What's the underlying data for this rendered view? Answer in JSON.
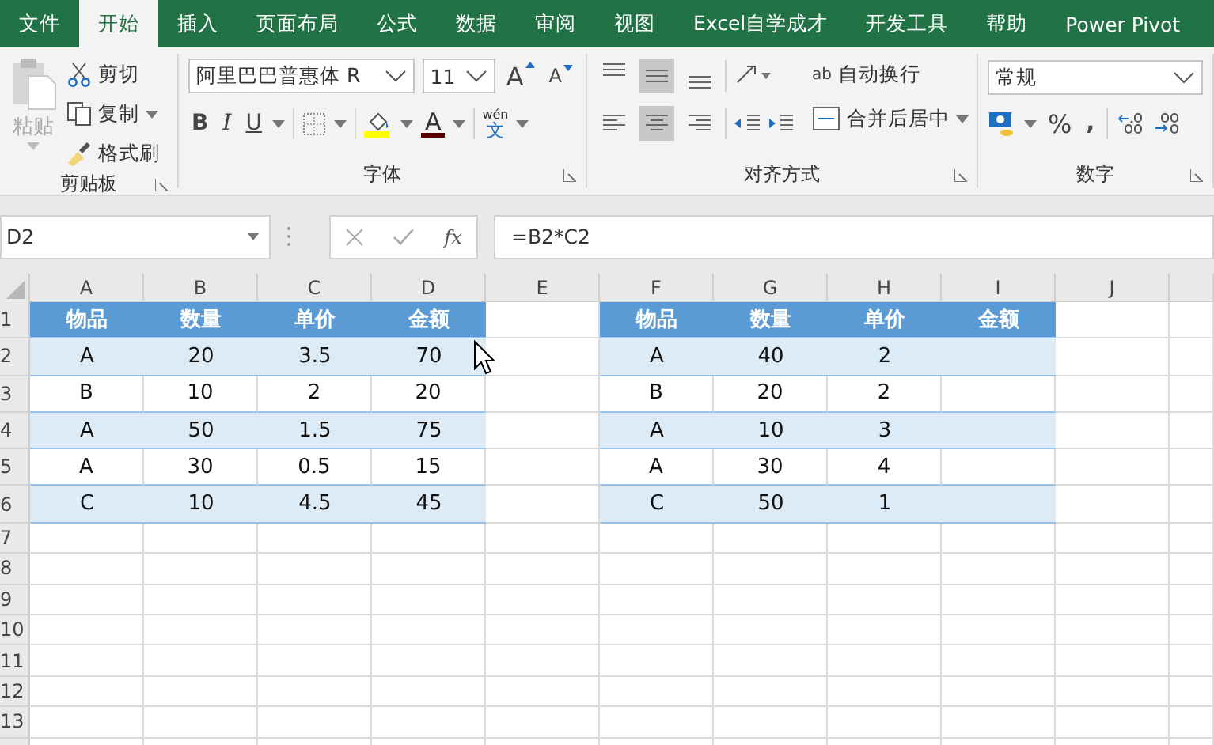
{
  "tabs": [
    {
      "label": "文件",
      "selected": false
    },
    {
      "label": "开始",
      "selected": true
    },
    {
      "label": "插入",
      "selected": false
    },
    {
      "label": "页面布局",
      "selected": false
    },
    {
      "label": "公式",
      "selected": false
    },
    {
      "label": "数据",
      "selected": false
    },
    {
      "label": "审阅",
      "selected": false
    },
    {
      "label": "视图",
      "selected": false
    },
    {
      "label": "Excel自学成才",
      "selected": false
    },
    {
      "label": "开发工具",
      "selected": false
    },
    {
      "label": "帮助",
      "selected": false
    },
    {
      "label": "Power Pivot",
      "selected": false
    }
  ],
  "clipboard": {
    "paste": "粘贴",
    "cut": "剪切",
    "copy": "复制",
    "painter": "格式刷",
    "label": "剪贴板"
  },
  "font": {
    "name": "阿里巴巴普惠体 R",
    "size": "11",
    "grow": "A",
    "shrink": "A",
    "bold": "B",
    "italic": "I",
    "underline": "U",
    "color_letter": "A",
    "phonetic_top": "wén",
    "phonetic_bottom": "文",
    "label": "字体"
  },
  "alignment": {
    "top_row": [
      {
        "kind": "top",
        "selected": false
      },
      {
        "kind": "middle",
        "selected": true
      },
      {
        "kind": "bottom",
        "selected": false
      }
    ],
    "bottom_row": [
      {
        "kind": "left",
        "selected": false
      },
      {
        "kind": "center",
        "selected": true
      },
      {
        "kind": "right",
        "selected": false
      }
    ],
    "wrap_icon": "ab",
    "wrap": "自动换行",
    "merge": "合并后居中",
    "label": "对齐方式"
  },
  "number": {
    "format": "常规",
    "percent": "%",
    "comma": ",",
    "label": "数字"
  },
  "formula_bar": {
    "name_box": "D2",
    "fx": "fx",
    "formula": "=B2*C2"
  },
  "sheet": {
    "columns": [
      "A",
      "B",
      "C",
      "D",
      "E",
      "F",
      "G",
      "H",
      "I",
      "J"
    ],
    "rows": [
      {
        "number": "1",
        "cells": [
          {
            "text": "物品",
            "kind": "header"
          },
          {
            "text": "数量",
            "kind": "header"
          },
          {
            "text": "单价",
            "kind": "header"
          },
          {
            "text": "金额",
            "kind": "header"
          },
          {
            "kind": "empty"
          },
          {
            "text": "物品",
            "kind": "header"
          },
          {
            "text": "数量",
            "kind": "header"
          },
          {
            "text": "单价",
            "kind": "header"
          },
          {
            "text": "金额",
            "kind": "header"
          },
          {
            "kind": "empty"
          }
        ]
      },
      {
        "number": "2",
        "cells": [
          {
            "text": "A",
            "kind": "band"
          },
          {
            "text": "20",
            "kind": "band"
          },
          {
            "text": "3.5",
            "kind": "band"
          },
          {
            "text": "70",
            "kind": "band"
          },
          {
            "kind": "empty"
          },
          {
            "text": "A",
            "kind": "band"
          },
          {
            "text": "40",
            "kind": "band"
          },
          {
            "text": "2",
            "kind": "band"
          },
          {
            "kind": "band"
          },
          {
            "kind": "empty"
          }
        ]
      },
      {
        "number": "3",
        "cells": [
          {
            "text": "B",
            "kind": "plain"
          },
          {
            "text": "10",
            "kind": "plain"
          },
          {
            "text": "2",
            "kind": "plain"
          },
          {
            "text": "20",
            "kind": "plain"
          },
          {
            "kind": "empty"
          },
          {
            "text": "B",
            "kind": "plain"
          },
          {
            "text": "20",
            "kind": "plain"
          },
          {
            "text": "2",
            "kind": "plain"
          },
          {
            "kind": "plain"
          },
          {
            "kind": "empty"
          }
        ]
      },
      {
        "number": "4",
        "cells": [
          {
            "text": "A",
            "kind": "band"
          },
          {
            "text": "50",
            "kind": "band"
          },
          {
            "text": "1.5",
            "kind": "band"
          },
          {
            "text": "75",
            "kind": "band"
          },
          {
            "kind": "empty"
          },
          {
            "text": "A",
            "kind": "band"
          },
          {
            "text": "10",
            "kind": "band"
          },
          {
            "text": "3",
            "kind": "band"
          },
          {
            "kind": "band"
          },
          {
            "kind": "empty"
          }
        ]
      },
      {
        "number": "5",
        "cells": [
          {
            "text": "A",
            "kind": "plain"
          },
          {
            "text": "30",
            "kind": "plain"
          },
          {
            "text": "0.5",
            "kind": "plain"
          },
          {
            "text": "15",
            "kind": "plain"
          },
          {
            "kind": "empty"
          },
          {
            "text": "A",
            "kind": "plain"
          },
          {
            "text": "30",
            "kind": "plain"
          },
          {
            "text": "4",
            "kind": "plain"
          },
          {
            "kind": "plain"
          },
          {
            "kind": "empty"
          }
        ]
      },
      {
        "number": "6",
        "cells": [
          {
            "text": "C",
            "kind": "band"
          },
          {
            "text": "10",
            "kind": "band"
          },
          {
            "text": "4.5",
            "kind": "band"
          },
          {
            "text": "45",
            "kind": "band"
          },
          {
            "kind": "empty"
          },
          {
            "text": "C",
            "kind": "band"
          },
          {
            "text": "50",
            "kind": "band"
          },
          {
            "text": "1",
            "kind": "band"
          },
          {
            "kind": "band"
          },
          {
            "kind": "empty"
          }
        ]
      },
      {
        "number": "7"
      },
      {
        "number": "8"
      },
      {
        "number": "9"
      },
      {
        "number": "10"
      },
      {
        "number": "11"
      },
      {
        "number": "12"
      },
      {
        "number": "13"
      }
    ]
  }
}
